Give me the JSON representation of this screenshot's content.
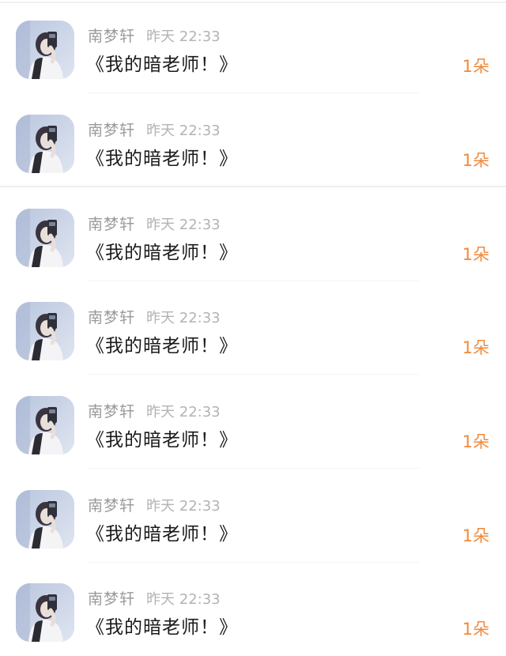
{
  "comments": [
    {
      "user": "南梦轩",
      "time": "昨天 22:33",
      "text": "《我的暗老师！》",
      "count": "1朵"
    },
    {
      "user": "南梦轩",
      "time": "昨天 22:33",
      "text": "《我的暗老师！》",
      "count": "1朵"
    },
    {
      "user": "南梦轩",
      "time": "昨天 22:33",
      "text": "《我的暗老师！》",
      "count": "1朵"
    },
    {
      "user": "南梦轩",
      "time": "昨天 22:33",
      "text": "《我的暗老师！》",
      "count": "1朵"
    },
    {
      "user": "南梦轩",
      "time": "昨天 22:33",
      "text": "《我的暗老师！》",
      "count": "1朵"
    },
    {
      "user": "南梦轩",
      "time": "昨天 22:33",
      "text": "《我的暗老师！》",
      "count": "1朵"
    },
    {
      "user": "南梦轩",
      "time": "昨天 22:33",
      "text": "《我的暗老师！》",
      "count": "1朵"
    }
  ],
  "colors": {
    "username": "#9a9a9a",
    "timestamp": "#b3b3b3",
    "message": "#1a1a1a",
    "count_accent": "#f08a3c"
  },
  "icons": {
    "avatar": "user-avatar-photo"
  }
}
